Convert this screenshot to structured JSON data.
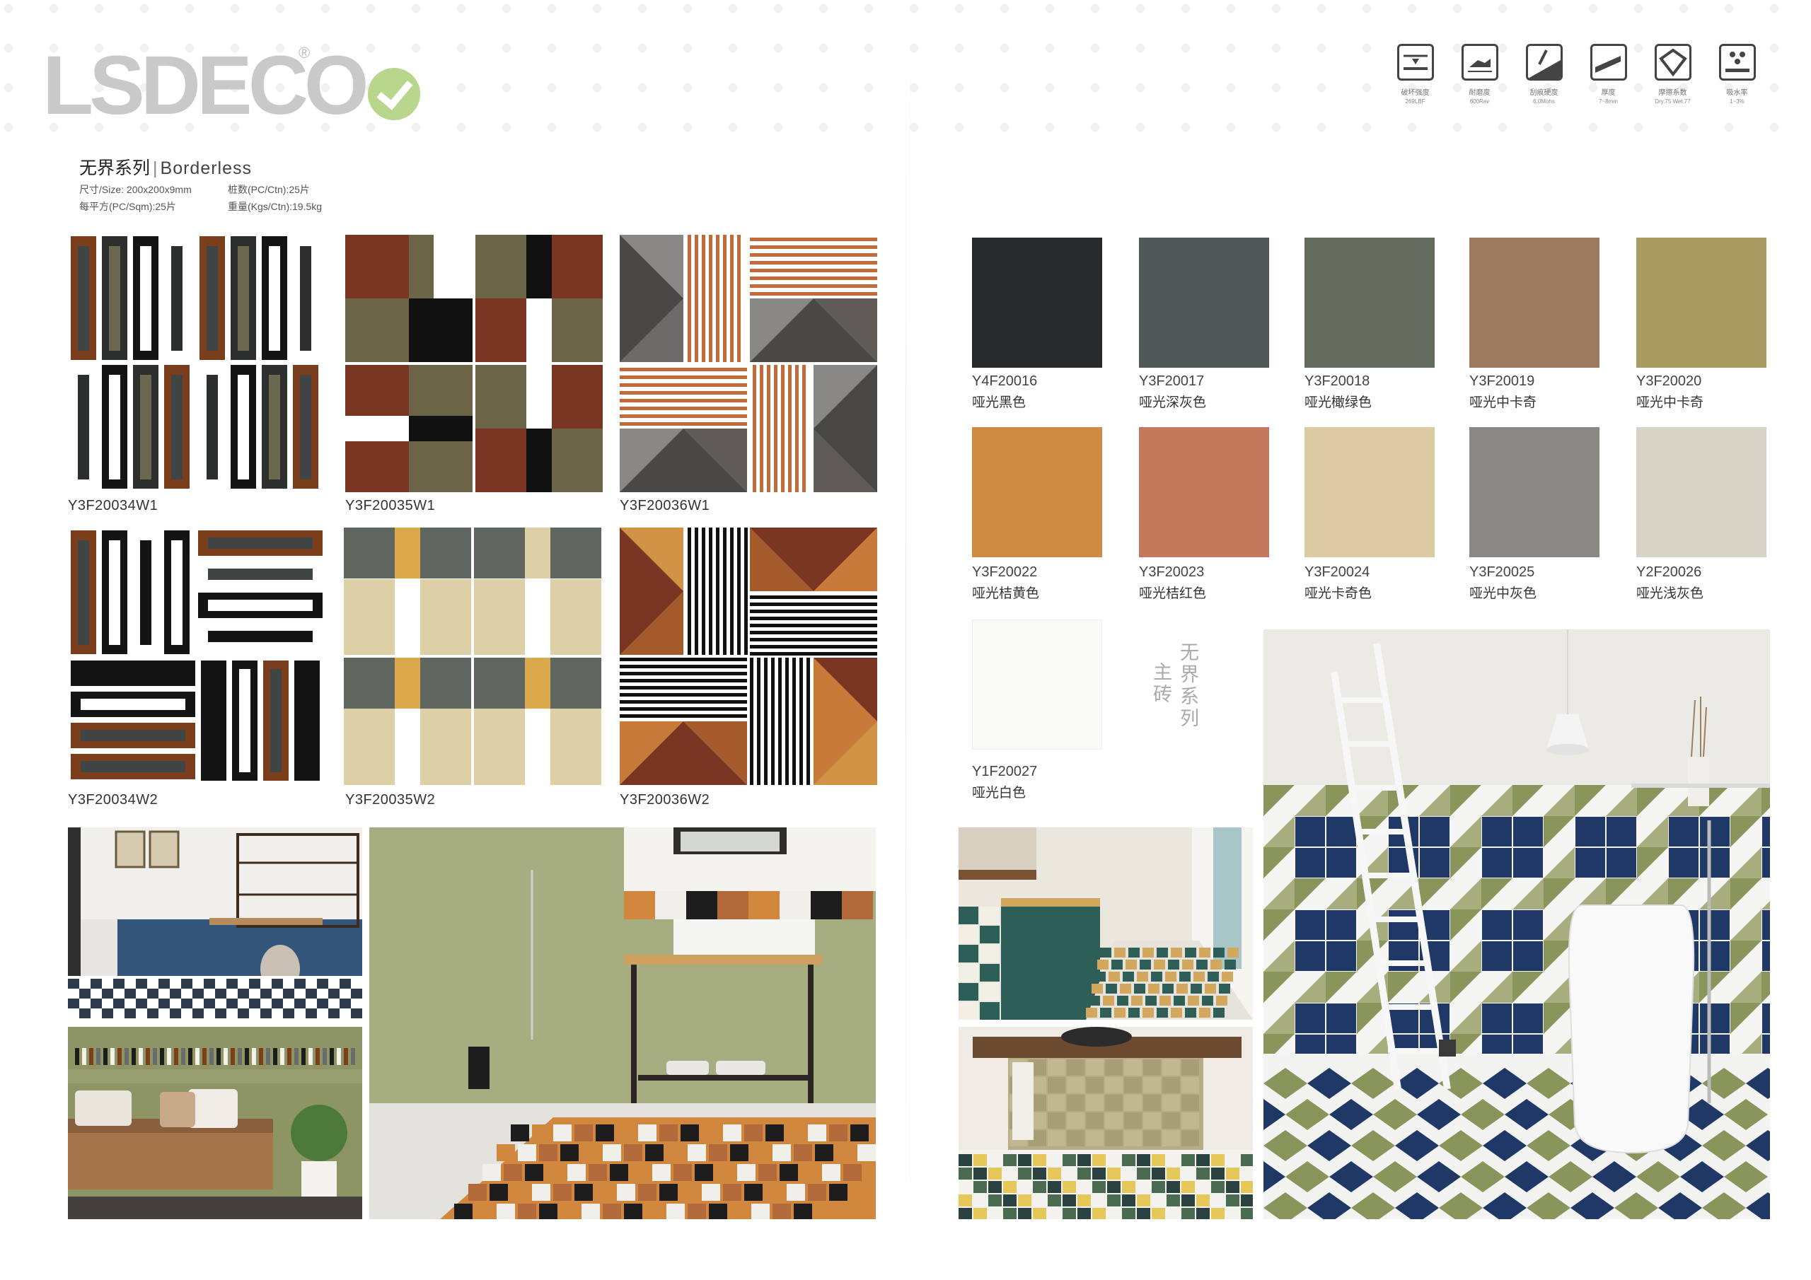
{
  "brand": {
    "logo_text": "LSDECO",
    "registered": "®"
  },
  "series": {
    "title_cn": "无界系列",
    "title_en": "Borderless",
    "specs": {
      "size": "尺寸/Size: 200x200x9mm",
      "pcs_ctn": "桩数(PC/Ctn):25片",
      "pcs_sqm": "每平方(PC/Sqm):25片",
      "weight": "重量(Kgs/Ctn):19.5kg"
    }
  },
  "properties": [
    {
      "icon": "breaking-strength-icon",
      "label": "破坏强度",
      "value": "269LBF"
    },
    {
      "icon": "abrasion-icon",
      "label": "耐磨度",
      "value": "600Rev"
    },
    {
      "icon": "scratch-hardness-icon",
      "label": "刮痕硬度",
      "value": "6.0Mohs"
    },
    {
      "icon": "thickness-icon",
      "label": "厚度",
      "value": "7~8mm"
    },
    {
      "icon": "friction-icon",
      "label": "摩擦系数",
      "value": "Dry.75 Wet.77"
    },
    {
      "icon": "water-absorption-icon",
      "label": "吸水率",
      "value": "1~3%"
    }
  ],
  "pattern_tiles": [
    {
      "code": "Y3F20034W1"
    },
    {
      "code": "Y3F20035W1"
    },
    {
      "code": "Y3F20036W1"
    },
    {
      "code": "Y3F20034W2"
    },
    {
      "code": "Y3F20035W2"
    },
    {
      "code": "Y3F20036W2"
    }
  ],
  "colors": [
    {
      "code": "Y4F20016",
      "name": "哑光黑色",
      "hex": "#27292a"
    },
    {
      "code": "Y3F20017",
      "name": "哑光深灰色",
      "hex": "#4f5857"
    },
    {
      "code": "Y3F20018",
      "name": "哑光橄绿色",
      "hex": "#636b5e"
    },
    {
      "code": "Y3F20019",
      "name": "哑光中卡奇",
      "hex": "#9c7b5f"
    },
    {
      "code": "Y3F20020",
      "name": "哑光中卡奇",
      "hex": "#a99c63"
    },
    {
      "code": "Y3F20022",
      "name": "哑光桔黄色",
      "hex": "#ce8a40"
    },
    {
      "code": "Y3F20023",
      "name": "哑光桔红色",
      "hex": "#c5795c"
    },
    {
      "code": "Y3F20024",
      "name": "哑光卡奇色",
      "hex": "#dccaa3"
    },
    {
      "code": "Y3F20025",
      "name": "哑光中灰色",
      "hex": "#8b8986"
    },
    {
      "code": "Y2F20026",
      "name": "哑光浅灰色",
      "hex": "#d8d3c7"
    },
    {
      "code": "Y1F20027",
      "name": "哑光白色",
      "hex": "#f9f9f8"
    }
  ],
  "vertical_labels": {
    "col1": "无界系列",
    "col2": "主砖"
  },
  "scenes": [
    {
      "name": "living-room-scene"
    },
    {
      "name": "bench-scene"
    },
    {
      "name": "shower-bathroom-scene"
    },
    {
      "name": "bakery-counter-scene"
    },
    {
      "name": "washbasin-scene"
    },
    {
      "name": "ladder-bathroom-scene"
    }
  ],
  "palette": {
    "accent_green": "#b8d68c",
    "olive": "#7e8c54",
    "navy": "#243a66"
  }
}
